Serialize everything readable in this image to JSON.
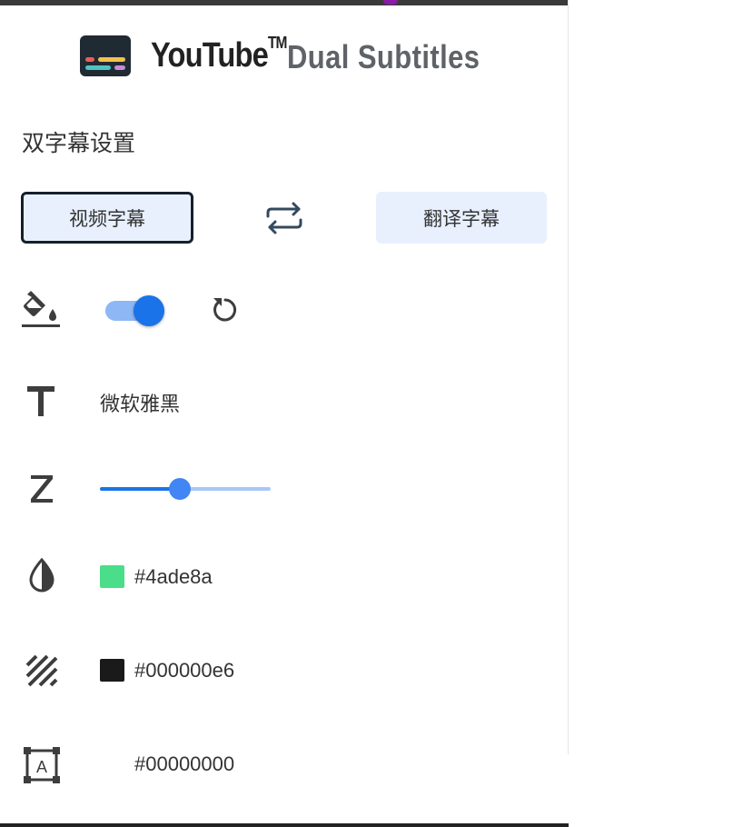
{
  "app": {
    "brand": "YouTube",
    "trademark": "TM",
    "subtitle": "Dual Subtitles"
  },
  "section_title": "双字幕设置",
  "tabs": {
    "video_label": "视频字幕",
    "translated_label": "翻译字幕",
    "active": "video"
  },
  "style": {
    "enabled": true,
    "font_family": "微软雅黑",
    "font_size_fraction": 0.47,
    "text_color": "#4ade8a",
    "background_color": "#000000e6",
    "outline_color": "#00000000"
  },
  "colors": {
    "accent": "#1a73e8",
    "tab_bg": "#e8f0fe",
    "text_swatch": "#4ade8a",
    "bg_swatch": "#1a1a1a"
  },
  "icons": {
    "fill": "fill-bucket-icon",
    "swap": "swap-icon",
    "reset": "reset-icon",
    "font": "text-font-icon",
    "size": "font-size-icon",
    "color": "contrast-drop-icon",
    "background": "stripes-icon",
    "outline": "text-box-icon"
  }
}
